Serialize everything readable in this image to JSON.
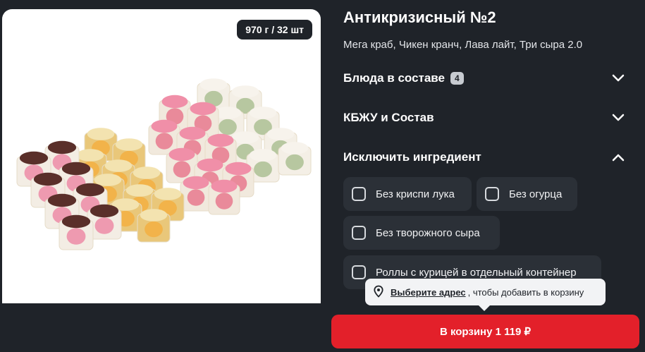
{
  "product": {
    "image_alt": "Сет роллов",
    "weight_badge": "970 г / 32 шт",
    "title": "Антикризисный №2",
    "subtitle": "Мега краб, Чикен кранч, Лава лайт, Три сыра 2.0"
  },
  "sections": [
    {
      "label": "Блюда в составе",
      "badge": "4",
      "icon": "chevron-down-icon",
      "expanded": false
    },
    {
      "label": "КБЖУ и Состав",
      "icon": "chevron-down-icon",
      "expanded": false
    },
    {
      "label": "Исключить ингредиент",
      "icon": "chevron-up-icon",
      "expanded": true
    }
  ],
  "exclude_options": [
    {
      "label": "Без криспи лука",
      "checked": false
    },
    {
      "label": "Без огурца",
      "checked": false
    },
    {
      "label": "Без творожного сыра",
      "checked": false
    },
    {
      "label": "Роллы с курицей в отдельный контейнер",
      "checked": false
    }
  ],
  "tooltip": {
    "icon": "location-pin-icon",
    "link": "Выберите адрес",
    "text": ", чтобы добавить в корзину"
  },
  "cart_button": {
    "label": "В корзину 1 119 ₽"
  },
  "colors": {
    "background": "#1f2329",
    "option_bg": "#2b3037",
    "accent": "#e3202a",
    "tooltip_bg": "#f2f3f5"
  }
}
